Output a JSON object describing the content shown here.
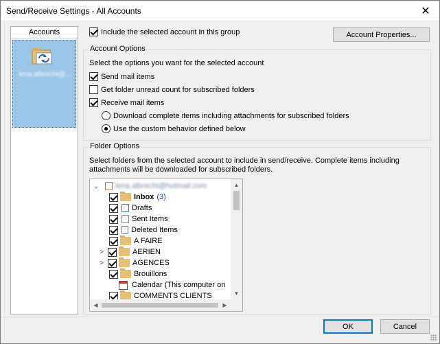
{
  "window": {
    "title": "Send/Receive Settings - All Accounts",
    "close_glyph": "✕"
  },
  "accounts_pane": {
    "header": "Accounts",
    "account_label": "lena.albrecht@..."
  },
  "include_account": {
    "label": "Include the selected account in this group",
    "checked": true
  },
  "account_properties_button": "Account Properties...",
  "account_options": {
    "title": "Account Options",
    "description": "Select the options you want for the selected account",
    "send_mail": {
      "label": "Send mail items",
      "checked": true
    },
    "unread_count": {
      "label": "Get folder unread count for subscribed folders",
      "checked": false
    },
    "receive_mail": {
      "label": "Receive mail items",
      "checked": true
    },
    "download_complete": {
      "label": "Download complete items including attachments for subscribed folders",
      "selected": false
    },
    "custom_behavior": {
      "label": "Use the custom behavior defined below",
      "selected": true
    }
  },
  "folder_options": {
    "title": "Folder Options",
    "description_line1": "Select folders from the selected account to include in send/receive. Complete items including",
    "description_line2": "attachments will be downloaded for subscribed folders.",
    "tree": {
      "root": {
        "label": "lena.albrecht@hotmail.com",
        "expander": "⌄",
        "checked": true
      },
      "items": [
        {
          "label": "Inbox",
          "count": "(3)",
          "bold": true,
          "icon": "inbox-folder-icon",
          "expander": ""
        },
        {
          "label": "Drafts",
          "icon": "drafts-icon",
          "expander": ""
        },
        {
          "label": "Sent Items",
          "icon": "sent-items-icon",
          "expander": ""
        },
        {
          "label": "Deleted Items",
          "icon": "deleted-items-icon",
          "expander": ""
        },
        {
          "label": "A FAIRE",
          "icon": "folder-icon",
          "expander": ""
        },
        {
          "label": "AERIEN",
          "icon": "folder-icon",
          "expander": ">"
        },
        {
          "label": "AGENCES",
          "icon": "folder-icon",
          "expander": ">"
        },
        {
          "label": "Brouillons",
          "icon": "folder-icon",
          "expander": ""
        },
        {
          "label": "Calendar (This computer on",
          "icon": "calendar-icon",
          "expander": ""
        },
        {
          "label": "COMMENTS CLIENTS",
          "icon": "folder-icon",
          "expander": ""
        }
      ]
    }
  },
  "buttons": {
    "ok": "OK",
    "cancel": "Cancel"
  },
  "colors": {
    "selection": "#9cc6e8",
    "default_button_border": "#0078d7",
    "link_count": "#1f3fbf"
  }
}
